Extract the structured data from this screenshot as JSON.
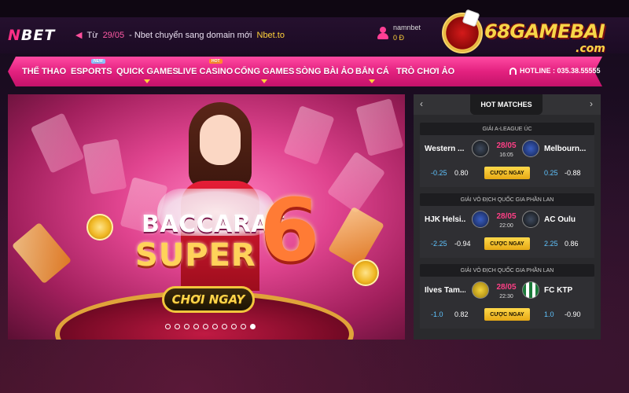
{
  "brand": {
    "logo_prefix": "N",
    "logo_suffix": "BET"
  },
  "announcement": {
    "icon": "megaphone-icon",
    "prefix": "Từ",
    "date": "29/05",
    "text": "- Nbet chuyển sang domain mới",
    "domain": "Nbet.to"
  },
  "user": {
    "name": "namnbet",
    "balance": "0 Đ"
  },
  "watermark": {
    "main": "68GAMEBAI",
    "sub": ".com"
  },
  "nav": {
    "items": [
      {
        "label": "THỂ THAO",
        "caret": false,
        "badge": ""
      },
      {
        "label": "ESPORTS",
        "caret": false,
        "badge": "NEW"
      },
      {
        "label": "QUICK GAMES",
        "caret": true,
        "badge": ""
      },
      {
        "label": "LIVE CASINO",
        "caret": false,
        "badge": "HOT"
      },
      {
        "label": "CỔNG GAMES",
        "caret": true,
        "badge": ""
      },
      {
        "label": "SÒNG BÀI ẢO",
        "caret": false,
        "badge": ""
      },
      {
        "label": "BẮN CÁ",
        "caret": true,
        "badge": ""
      },
      {
        "label": "TRÒ CHƠI ẢO",
        "caret": false,
        "badge": ""
      }
    ],
    "hotline": "HOTLINE : 035.38.55555"
  },
  "banner": {
    "title_line1": "BACCARAT",
    "title_line2": "SUPER",
    "title_number": "6",
    "cta": "CHƠI NGAY",
    "slides_total": 10,
    "active_slide": 10
  },
  "hot_matches": {
    "title": "HOT MATCHES",
    "prev": "‹",
    "next": "›",
    "bet_label": "CƯỢC NGAY",
    "matches": [
      {
        "league": "GIẢI A-LEAGUE ÚC",
        "home": "Western ...",
        "away": "Melbourn...",
        "date": "28/05",
        "time": "16:05",
        "home_handicap": "-0.25",
        "home_odds": "0.80",
        "away_handicap": "0.25",
        "away_odds": "-0.88"
      },
      {
        "league": "GIẢI VÔ ĐỊCH QUỐC GIA PHẦN LAN",
        "home": "HJK Helsi...",
        "away": "AC Oulu",
        "date": "28/05",
        "time": "22:00",
        "home_handicap": "-2.25",
        "home_odds": "-0.94",
        "away_handicap": "2.25",
        "away_odds": "0.86"
      },
      {
        "league": "GIẢI VÔ ĐỊCH QUỐC GIA PHẦN LAN",
        "home": "Ilves Tam...",
        "away": "FC KTP",
        "date": "28/05",
        "time": "22:30",
        "home_handicap": "-1.0",
        "home_odds": "0.82",
        "away_handicap": "1.0",
        "away_odds": "-0.90"
      }
    ]
  },
  "colors": {
    "accent_pink": "#e3217f",
    "gold": "#ffd23a",
    "odds_blue": "#5fc4ff",
    "date_pink": "#ff3f86"
  }
}
